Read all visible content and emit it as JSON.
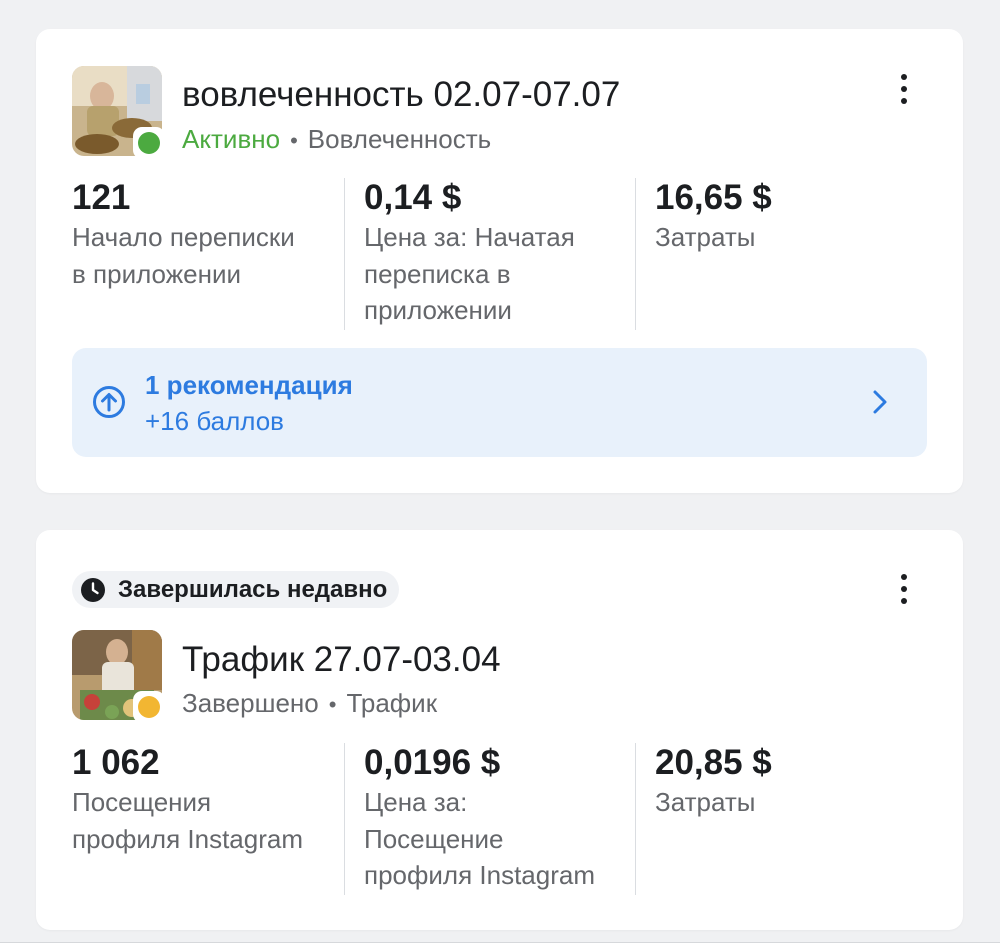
{
  "campaigns": [
    {
      "title": "вовлеченность 02.07-07.07",
      "status": "Активно",
      "status_color": "#4caa40",
      "objective": "Вовлеченность",
      "metrics": [
        {
          "value": "121",
          "label_lines": [
            "Начало переписки",
            "в приложении"
          ]
        },
        {
          "value": "0,14 $",
          "label_lines": [
            "Цена за: Начатая",
            "переписка в",
            "приложении"
          ]
        },
        {
          "value": "16,65 $",
          "label_lines": [
            "Затраты"
          ]
        }
      ],
      "recommendation": {
        "title": "1 рекомендация",
        "subtitle": "+16 баллов"
      }
    },
    {
      "badge": "Завершилась недавно",
      "title": "Трафик 27.07-03.04",
      "status": "Завершено",
      "status_color": "#f2b632",
      "objective": "Трафик",
      "metrics": [
        {
          "value": "1 062",
          "label_lines": [
            "Посещения",
            "профиля Instagram"
          ]
        },
        {
          "value": "0,0196 $",
          "label_lines": [
            "Цена за:",
            "Посещение",
            "профиля Instagram"
          ]
        },
        {
          "value": "20,85 $",
          "label_lines": [
            "Затраты"
          ]
        }
      ]
    }
  ],
  "icons": {
    "more": "more-vertical-icon",
    "recommendation": "arrow-up-circle-icon",
    "chevron": "chevron-right-icon",
    "badge": "clock-icon"
  },
  "colors": {
    "accent_blue": "#2d7be0",
    "recommendation_bg": "#e8f1fb",
    "secondary_text": "#65676b"
  }
}
